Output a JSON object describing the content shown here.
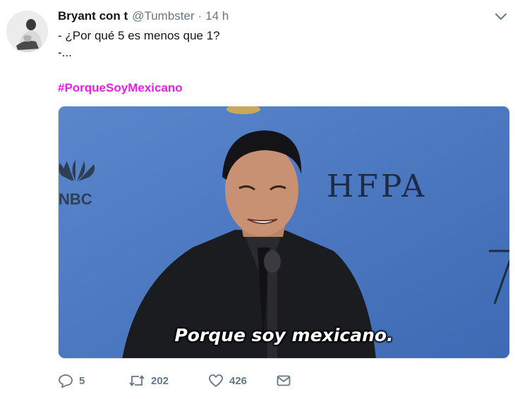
{
  "tweet": {
    "display_name": "Bryant con t",
    "handle": "@Tumbster",
    "separator": "·",
    "time": "14 h",
    "line1": "- ¿Por qué 5 es menos que 1?",
    "line2": "-...",
    "hashtag": "#PorqueSoyMexicano",
    "hashtag_color": "#e620e0"
  },
  "media": {
    "subtitle": "Porque soy mexicano.",
    "backdrop_text": "HFPA",
    "logo_text": "NBC"
  },
  "actions": {
    "reply_count": "5",
    "retweet_count": "202",
    "like_count": "426"
  },
  "icons": {
    "caret": "chevron-down-icon",
    "reply": "reply-icon",
    "retweet": "retweet-icon",
    "like": "heart-icon",
    "dm": "envelope-icon"
  }
}
